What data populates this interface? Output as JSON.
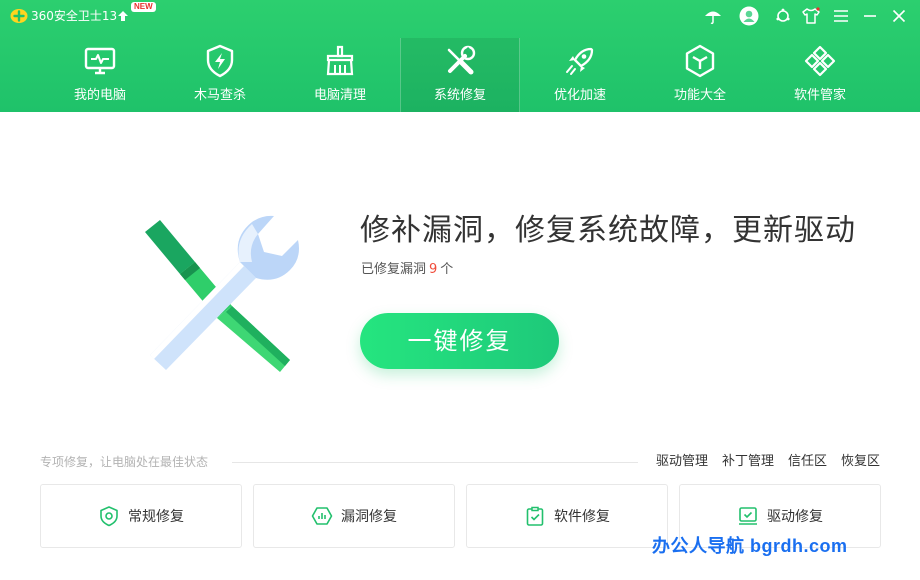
{
  "titlebar": {
    "app_title": "360安全卫士13",
    "new_badge": "NEW"
  },
  "nav": {
    "items": [
      {
        "label": "我的电脑",
        "icon": "monitor-icon",
        "active": false
      },
      {
        "label": "木马查杀",
        "icon": "shield-bolt-icon",
        "active": false
      },
      {
        "label": "电脑清理",
        "icon": "broom-icon",
        "active": false
      },
      {
        "label": "系统修复",
        "icon": "wrench-screwdriver-icon",
        "active": true
      },
      {
        "label": "优化加速",
        "icon": "rocket-icon",
        "active": false
      },
      {
        "label": "功能大全",
        "icon": "cube-icon",
        "active": false
      },
      {
        "label": "软件管家",
        "icon": "apps-icon",
        "active": false
      }
    ]
  },
  "hero": {
    "title": "修补漏洞，修复系统故障，更新驱动",
    "sub_prefix": "已修复漏洞",
    "sub_count": "9",
    "sub_suffix": "个",
    "button_label": "一键修复"
  },
  "section": {
    "label": "专项修复，让电脑处在最佳状态",
    "links": [
      "驱动管理",
      "补丁管理",
      "信任区",
      "恢复区"
    ]
  },
  "cards": [
    {
      "label": "常规修复",
      "icon": "shield-icon"
    },
    {
      "label": "漏洞修复",
      "icon": "hexagon-chart-icon"
    },
    {
      "label": "软件修复",
      "icon": "clipboard-check-icon"
    },
    {
      "label": "驱动修复",
      "icon": "device-icon"
    }
  ],
  "watermark": "办公人导航 bgrdh.com",
  "colors": {
    "header_green": "#1fc26a",
    "button_green": "#25e57f",
    "count_red": "#f04b3a",
    "watermark_blue": "#1a6ff0"
  }
}
